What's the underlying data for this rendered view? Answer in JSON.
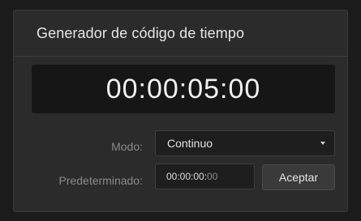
{
  "panel": {
    "title": "Generador de código de tiempo",
    "display_timecode": "00:00:05:00"
  },
  "mode": {
    "label": "Modo:",
    "selected": "Continuo"
  },
  "preset": {
    "label": "Predeterminado:",
    "value_main": "00:00:00:",
    "value_frames": "00"
  },
  "actions": {
    "accept_label": "Aceptar"
  },
  "colors": {
    "panel_bg": "#2b2b2b",
    "display_bg": "#161616",
    "label_text": "#8a8a8a"
  }
}
